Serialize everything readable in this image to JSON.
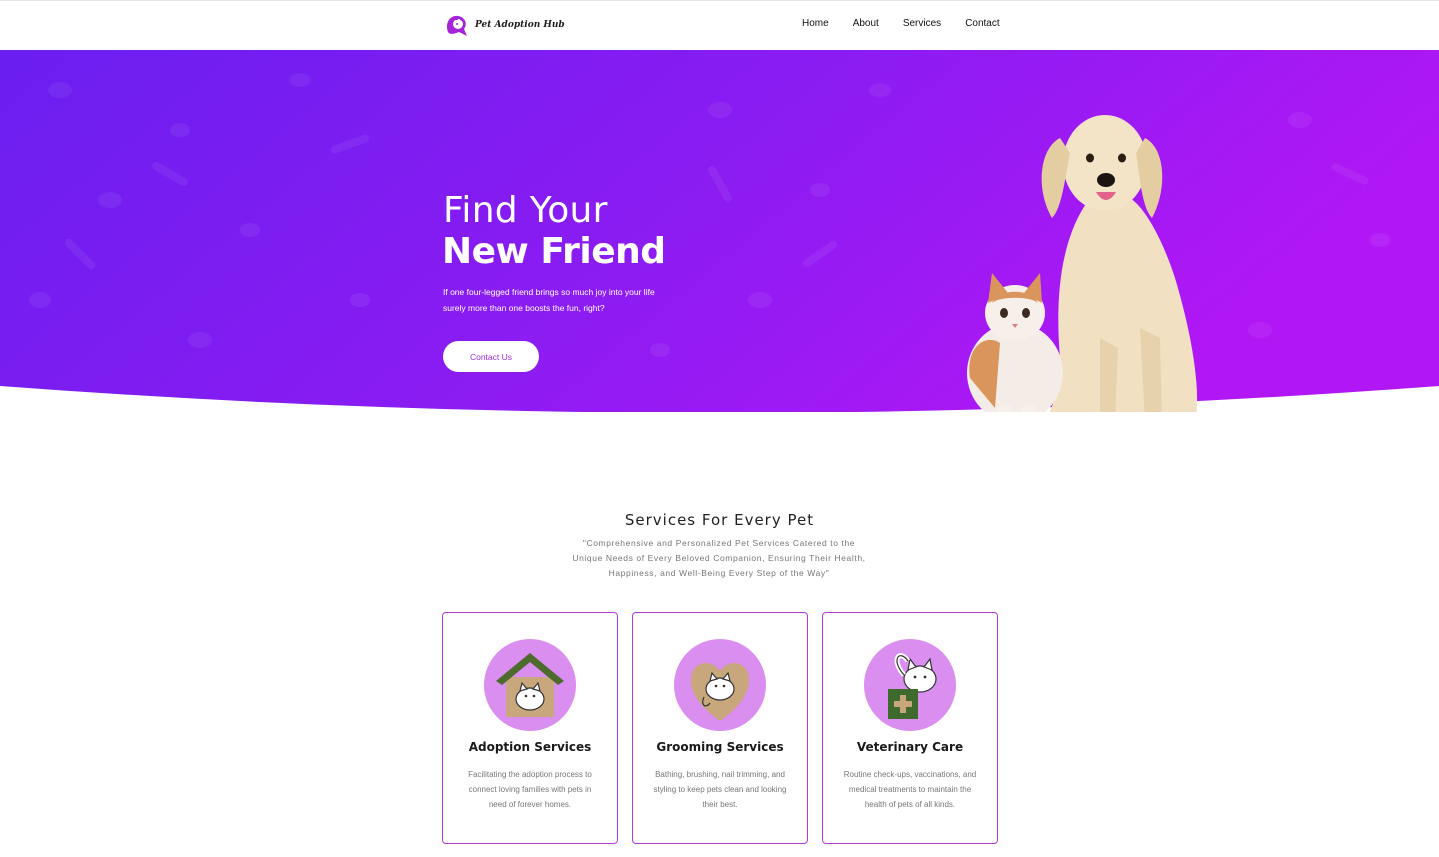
{
  "header": {
    "brand": "Pet Adoption Hub",
    "nav": [
      {
        "label": "Home"
      },
      {
        "label": "About"
      },
      {
        "label": "Services"
      },
      {
        "label": "Contact"
      }
    ]
  },
  "hero": {
    "title_light": "Find Your",
    "title_bold": "New Friend",
    "subtitle_line1": "If one four-legged friend brings so much joy into your life",
    "subtitle_line2": "surely more than one boosts the fun, right?",
    "cta_label": "Contact Us"
  },
  "services": {
    "title": "Services For Every Pet",
    "subtitle": "\"Comprehensive and Personalized Pet Services Catered to the Unique Needs of Every Beloved Companion, Ensuring Their Health, Happiness, and Well-Being Every Step of the Way\"",
    "cards": [
      {
        "title": "Adoption Services",
        "description": "Facilitating the adoption process to connect loving families with pets in need of forever homes.",
        "icon": "cat-house-icon"
      },
      {
        "title": "Grooming Services",
        "description": "Bathing, brushing, nail trimming, and styling to keep pets clean and looking their best.",
        "icon": "cat-heart-icon"
      },
      {
        "title": "Veterinary Care",
        "description": "Routine check-ups, vaccinations, and medical treatments to maintain the health of pets of all kinds.",
        "icon": "cat-medkit-icon"
      }
    ]
  },
  "colors": {
    "hero_gradient_start": "#6a1ef0",
    "hero_gradient_end": "#b117f5",
    "accent": "#b63ad6",
    "icon_circle": "#d98ef0"
  }
}
